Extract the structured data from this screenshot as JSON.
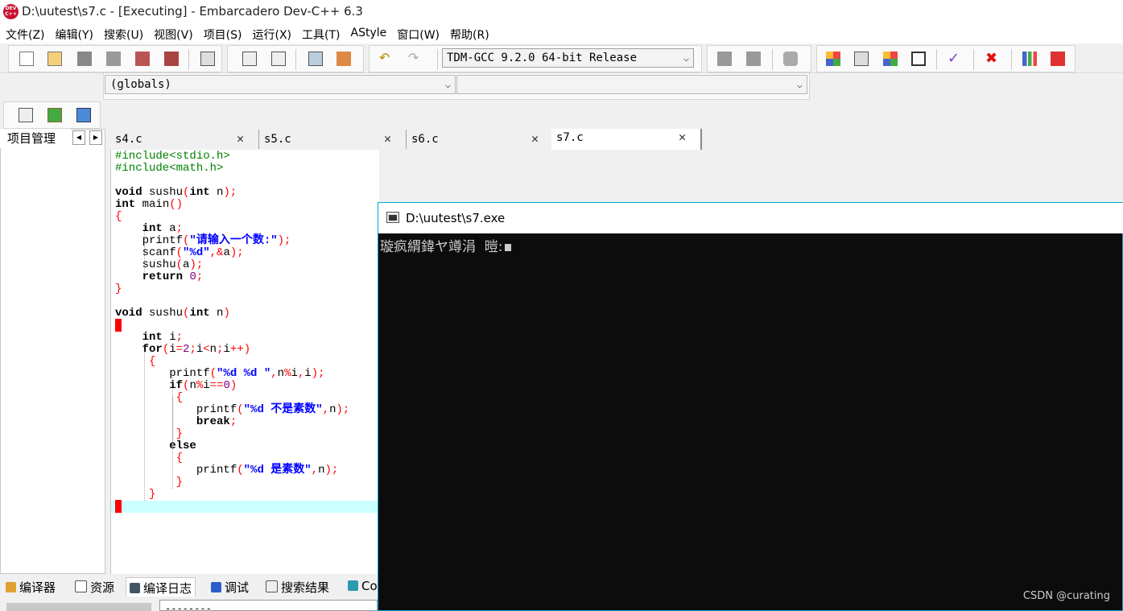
{
  "window": {
    "title": "D:\\uutest\\s7.c - [Executing] - Embarcadero Dev-C++ 6.3",
    "logo_text": "DEV C++"
  },
  "menu": [
    "文件(Z)",
    "编辑(Y)",
    "搜索(U)",
    "视图(V)",
    "项目(S)",
    "运行(X)",
    "工具(T)",
    "AStyle",
    "窗口(W)",
    "帮助(R)"
  ],
  "toolbar": {
    "compiler": "TDM-GCC 9.2.0 64-bit Release",
    "globals": "(globals)",
    "members": ""
  },
  "left_panel": {
    "tab_label": "项目管理"
  },
  "editor_tabs": [
    {
      "label": "s4.c"
    },
    {
      "label": "s5.c"
    },
    {
      "label": "s6.c"
    },
    {
      "label": "s7.c"
    }
  ],
  "code": [
    "#include<stdio.h>",
    "#include<math.h>",
    "",
    "void sushu(int n);",
    "int main()",
    "{",
    "    int a;",
    "    printf(\"请输入一个数:\");",
    "    scanf(\"%d\",&a);",
    "    sushu(a);",
    "    return 0;",
    "}",
    "",
    "void sushu(int n)",
    "{",
    "    int i;",
    "    for(i=2;i<n;i++)",
    "     {",
    "        printf(\"%d %d \",n%i,i);",
    "        if(n%i==0)",
    "         {",
    "            printf(\"%d 不是素数\",n);",
    "            break;",
    "         }",
    "        else",
    "         {",
    "            printf(\"%d 是素数\",n);",
    "         }",
    "     }",
    "}"
  ],
  "console": {
    "title": "D:\\uutest\\s7.exe",
    "output": "璇疯緭鍏ヤ竴涓  暟:",
    "watermark": "CSDN @curating"
  },
  "bottom_tabs": [
    {
      "label": "编译器",
      "icon": "compiler-icon"
    },
    {
      "label": "资源",
      "icon": "resource-icon"
    },
    {
      "label": "编译日志",
      "icon": "log-icon"
    },
    {
      "label": "调试",
      "icon": "debug-icon"
    },
    {
      "label": "搜索结果",
      "icon": "search-results-icon"
    },
    {
      "label": "Co",
      "icon": "console-icon"
    }
  ],
  "bottom_field": "--------"
}
